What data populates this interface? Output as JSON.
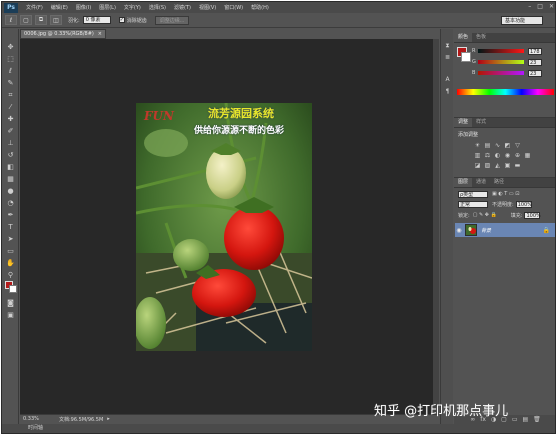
{
  "app": {
    "logo": "Ps"
  },
  "menu": [
    "文件(F)",
    "编辑(E)",
    "图像(I)",
    "图层(L)",
    "文字(Y)",
    "选择(S)",
    "滤镜(T)",
    "视图(V)",
    "窗口(W)",
    "帮助(H)"
  ],
  "window_buttons": [
    "–",
    "□",
    "✕"
  ],
  "options": {
    "feather_label": "羽化:",
    "feather_value": "0 像素",
    "antialias_label": "消除锯齿",
    "antialias_checked": "✓",
    "refine_edge": "调整边缘...",
    "workspace": "基本功能"
  },
  "document": {
    "tab": "0006.jpg @ 0.33%(RGB/8#)",
    "tab_close": "×",
    "title_line1": "流芳源园系统",
    "title_line2": "供给你源源不断的色彩",
    "logo_text": "FUN"
  },
  "status": {
    "zoom": "0.33%",
    "doc_info": "文档:96.5M/96.5M"
  },
  "timeline": "时间轴",
  "color_panel": {
    "tabs": [
      "颜色",
      "色板"
    ],
    "channels": [
      {
        "name": "R",
        "value": "178"
      },
      {
        "name": "G",
        "value": "23"
      },
      {
        "name": "B",
        "value": "23"
      }
    ],
    "foreground": "#b21717"
  },
  "adjustments_panel": {
    "tabs": [
      "调整",
      "样式"
    ],
    "title": "添加调整"
  },
  "layers_panel": {
    "tabs": [
      "图层",
      "通道",
      "路径"
    ],
    "filter_label": "ρ类型",
    "blend_mode": "正常",
    "opacity_label": "不透明度:",
    "opacity_value": "100%",
    "lock_label": "锁定:",
    "fill_label": "填充:",
    "fill_value": "100%",
    "layer_name": "背景",
    "bottom_icons": [
      "∞",
      "fx",
      "◑",
      "▢",
      "▭",
      "▤",
      "🗑"
    ]
  },
  "watermark": "知乎 @打印机那点事儿",
  "colors": {
    "ui_bg": "#535353",
    "canvas_bg": "#282828",
    "title_yellow": "#e8e82a",
    "logo_red": "#c0392b"
  }
}
